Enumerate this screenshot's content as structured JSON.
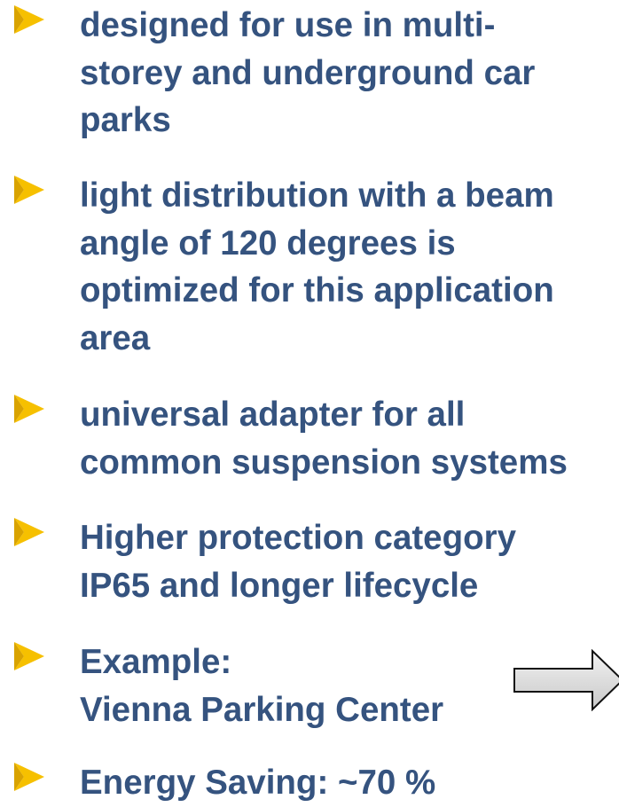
{
  "slide": {
    "accent_colors": {
      "text": "#35537F",
      "bullet": "#F6C000",
      "arrow_fill": "#D9D9D9"
    },
    "bullet_icon": "yellow-arrowhead-bullet",
    "bullets": [
      {
        "lines": [
          "designed for use in multi-",
          "storey and underground car",
          "parks"
        ]
      },
      {
        "lines": [
          "light distribution with a beam",
          "angle of 120 degrees is",
          "optimized for this application",
          "area"
        ]
      },
      {
        "lines": [
          "universal adapter for all",
          "common suspension systems"
        ]
      },
      {
        "lines": [
          "Higher protection category",
          "IP65 and longer lifecycle"
        ]
      },
      {
        "lines": [
          "Example:",
          "Vienna Parking Center"
        ]
      },
      {
        "lines": [
          "Energy Saving: ~70 %"
        ]
      }
    ],
    "pointer_icon": "right-pointing-block-arrow"
  }
}
